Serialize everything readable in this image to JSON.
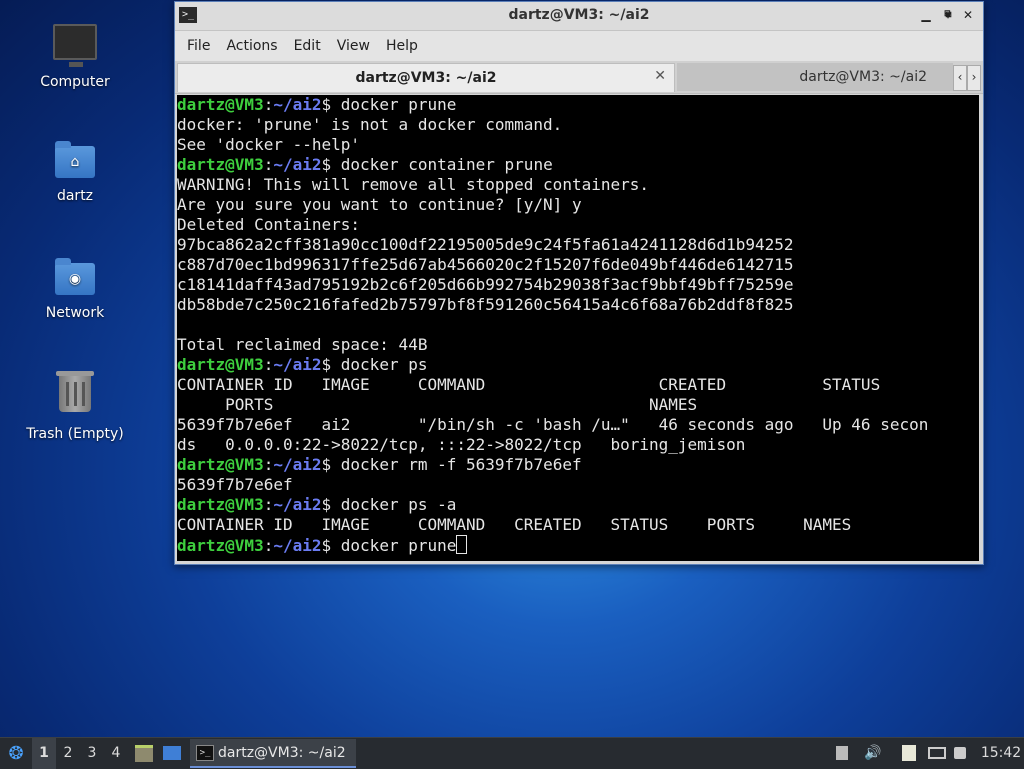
{
  "desktop": {
    "icons": [
      {
        "label": "Computer"
      },
      {
        "label": "dartz"
      },
      {
        "label": "Network"
      },
      {
        "label": "Trash (Empty)"
      }
    ]
  },
  "window": {
    "title": "dartz@VM3: ~/ai2",
    "menu": [
      "File",
      "Actions",
      "Edit",
      "View",
      "Help"
    ],
    "tabs": [
      {
        "label": "dartz@VM3: ~/ai2",
        "active": true
      },
      {
        "label": "dartz@VM3: ~/ai2",
        "active": false
      }
    ]
  },
  "terminal": {
    "prompt_user": "dartz@VM3",
    "prompt_sep": ":",
    "prompt_path": "~/ai2",
    "prompt_end": "$ ",
    "lines": [
      {
        "cmd": "docker prune"
      },
      {
        "out": "docker: 'prune' is not a docker command."
      },
      {
        "out": "See 'docker --help'"
      },
      {
        "cmd": "docker container prune"
      },
      {
        "out": "WARNING! This will remove all stopped containers."
      },
      {
        "out": "Are you sure you want to continue? [y/N] y"
      },
      {
        "out": "Deleted Containers:"
      },
      {
        "out": "97bca862a2cff381a90cc100df22195005de9c24f5fa61a4241128d6d1b94252"
      },
      {
        "out": "c887d70ec1bd996317ffe25d67ab4566020c2f15207f6de049bf446de6142715"
      },
      {
        "out": "c18141daff43ad795192b2c6f205d66b992754b29038f3acf9bbf49bff75259e"
      },
      {
        "out": "db58bde7c250c216fafed2b75797bf8f591260c56415a4c6f68a76b2ddf8f825"
      },
      {
        "out": ""
      },
      {
        "out": "Total reclaimed space: 44B"
      },
      {
        "cmd": "docker ps"
      },
      {
        "out": "CONTAINER ID   IMAGE     COMMAND                  CREATED          STATUS"
      },
      {
        "out": "     PORTS                                       NAMES"
      },
      {
        "out": "5639f7b7e6ef   ai2       \"/bin/sh -c 'bash /u…\"   46 seconds ago   Up 46 secon"
      },
      {
        "out": "ds   0.0.0.0:22->8022/tcp, :::22->8022/tcp   boring_jemison"
      },
      {
        "cmd": "docker rm -f 5639f7b7e6ef"
      },
      {
        "out": "5639f7b7e6ef"
      },
      {
        "cmd": "docker ps -a"
      },
      {
        "out": "CONTAINER ID   IMAGE     COMMAND   CREATED   STATUS    PORTS     NAMES"
      },
      {
        "cmd": "docker prune",
        "cursor": true
      }
    ]
  },
  "taskbar": {
    "workspaces": [
      "1",
      "2",
      "3",
      "4"
    ],
    "active_workspace": "1",
    "task_label": "dartz@VM3: ~/ai2",
    "clock": "15:42"
  }
}
